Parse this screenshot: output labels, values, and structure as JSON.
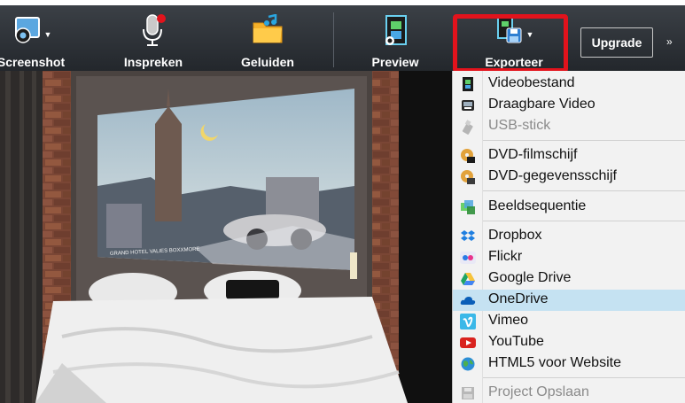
{
  "toolbar": {
    "buttons": [
      {
        "label": "Screenshot",
        "icon": "screenshot-icon"
      },
      {
        "label": "Inspreken",
        "icon": "microphone-icon"
      },
      {
        "label": "Geluiden",
        "icon": "music-folder-icon"
      },
      {
        "label": "Preview",
        "icon": "preview-film-icon"
      },
      {
        "label": "Exporteer",
        "icon": "export-disk-icon"
      }
    ],
    "upgrade_label": "Upgrade",
    "more_label": "»"
  },
  "export_menu": {
    "items": [
      {
        "label": "Videobestand",
        "icon": "film-icon",
        "enabled": true
      },
      {
        "label": "Draagbare Video",
        "icon": "portable-device-icon",
        "enabled": true
      },
      {
        "label": "USB-stick",
        "icon": "usb-icon",
        "enabled": false
      },
      {
        "label": "DVD-filmschijf",
        "icon": "dvd-icon",
        "enabled": true
      },
      {
        "label": "DVD-gegevensschijf",
        "icon": "dvd-data-icon",
        "enabled": true
      },
      {
        "label": "Beeldsequentie",
        "icon": "image-sequence-icon",
        "enabled": true
      },
      {
        "label": "Dropbox",
        "icon": "dropbox-icon",
        "enabled": true
      },
      {
        "label": "Flickr",
        "icon": "flickr-icon",
        "enabled": true
      },
      {
        "label": "Google Drive",
        "icon": "google-drive-icon",
        "enabled": true
      },
      {
        "label": "OneDrive",
        "icon": "onedrive-icon",
        "enabled": true,
        "selected": true
      },
      {
        "label": "Vimeo",
        "icon": "vimeo-icon",
        "enabled": true
      },
      {
        "label": "YouTube",
        "icon": "youtube-icon",
        "enabled": true
      },
      {
        "label": "HTML5 voor Website",
        "icon": "globe-icon",
        "enabled": true
      },
      {
        "label": "Project Opslaan",
        "icon": "save-project-icon",
        "enabled": false
      }
    ]
  },
  "photo": {
    "poster_caption": "GRAND HOTEL VALIES BOXXMORE"
  },
  "colors": {
    "toolbar_bg": "#2e3237",
    "highlight": "#e2131c",
    "menu_bg": "#f2f2f2",
    "menu_selected": "#c5e2f2"
  }
}
